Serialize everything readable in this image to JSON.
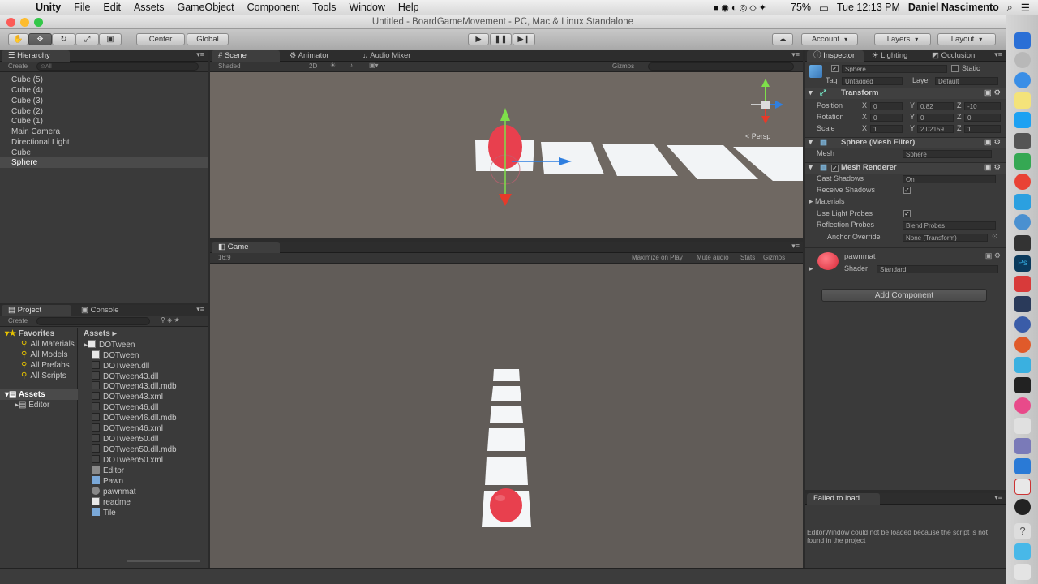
{
  "menubar": {
    "app": "Unity",
    "items": [
      "File",
      "Edit",
      "Assets",
      "GameObject",
      "Component",
      "Tools",
      "Window",
      "Help"
    ],
    "battery": "75%",
    "clock": "Tue 12:13 PM",
    "user": "Daniel Nascimento"
  },
  "window": {
    "title": "Untitled - BoardGameMovement - PC, Mac & Linux Standalone"
  },
  "toolbar": {
    "pivot": "Center",
    "space": "Global",
    "account": "Account",
    "layers": "Layers",
    "layout": "Layout"
  },
  "hierarchy": {
    "tab": "Hierarchy",
    "create": "Create",
    "search_placeholder": "⊙All",
    "items": [
      "Cube (5)",
      "Cube (4)",
      "Cube (3)",
      "Cube (2)",
      "Cube (1)",
      "Main Camera",
      "Directional Light",
      "Cube",
      "Sphere"
    ],
    "selected": "Sphere"
  },
  "scene": {
    "tabs": [
      "Scene",
      "Animator",
      "Audio Mixer"
    ],
    "shading": "Shaded",
    "mode_2d": "2D",
    "gizmos": "Gizmos",
    "persp": "< Persp"
  },
  "game": {
    "tab": "Game",
    "aspect": "16:9",
    "options": [
      "Maximize on Play",
      "Mute audio",
      "Stats",
      "Gizmos"
    ]
  },
  "project": {
    "tabs": [
      "Project",
      "Console"
    ],
    "create": "Create",
    "favorites_label": "Favorites",
    "favorites": [
      "All Materials",
      "All Models",
      "All Prefabs",
      "All Scripts"
    ],
    "assets_label": "Assets",
    "assets_tree": [
      "Editor"
    ],
    "breadcrumb": "Assets",
    "files": [
      "DOTween",
      "DOTween",
      "DOTween.dll",
      "DOTween43.dll",
      "DOTween43.dll.mdb",
      "DOTween43.xml",
      "DOTween46.dll",
      "DOTween46.dll.mdb",
      "DOTween46.xml",
      "DOTween50.dll",
      "DOTween50.dll.mdb",
      "DOTween50.xml",
      "Editor",
      "Pawn",
      "pawnmat",
      "readme",
      "Tile"
    ]
  },
  "inspector": {
    "tabs": [
      "Inspector",
      "Lighting",
      "Occlusion"
    ],
    "object_name": "Sphere",
    "static": "Static",
    "tag_label": "Tag",
    "tag_value": "Untagged",
    "layer_label": "Layer",
    "layer_value": "Default",
    "transform": {
      "title": "Transform",
      "position": {
        "label": "Position",
        "x": "0",
        "y": "0.82",
        "z": "-10"
      },
      "rotation": {
        "label": "Rotation",
        "x": "0",
        "y": "0",
        "z": "0"
      },
      "scale": {
        "label": "Scale",
        "x": "1",
        "y": "2.02159",
        "z": "1"
      }
    },
    "mesh_filter": {
      "title": "Sphere (Mesh Filter)",
      "mesh_label": "Mesh",
      "mesh_value": "Sphere"
    },
    "mesh_renderer": {
      "title": "Mesh Renderer",
      "cast_shadows": "Cast Shadows",
      "cast_shadows_value": "On",
      "receive_shadows": "Receive Shadows",
      "materials": "Materials",
      "light_probes": "Use Light Probes",
      "reflection_probes": "Reflection Probes",
      "reflection_value": "Blend Probes",
      "anchor_override": "Anchor Override",
      "anchor_value": "None (Transform)"
    },
    "material": {
      "name": "pawnmat",
      "shader_label": "Shader",
      "shader_value": "Standard"
    },
    "add_component": "Add Component"
  },
  "failed_panel": {
    "tab": "Failed to load",
    "message": "EditorWindow could not be loaded because the script is not found in the project"
  },
  "colors": {
    "accent_red": "#e8404e",
    "tile_white": "#f4f6f8",
    "scene_bg": "#6f6862",
    "game_bg": "#615c58",
    "axis_green": "#7ee04a",
    "axis_red": "#e53a2a",
    "axis_blue": "#2f7fe0"
  }
}
